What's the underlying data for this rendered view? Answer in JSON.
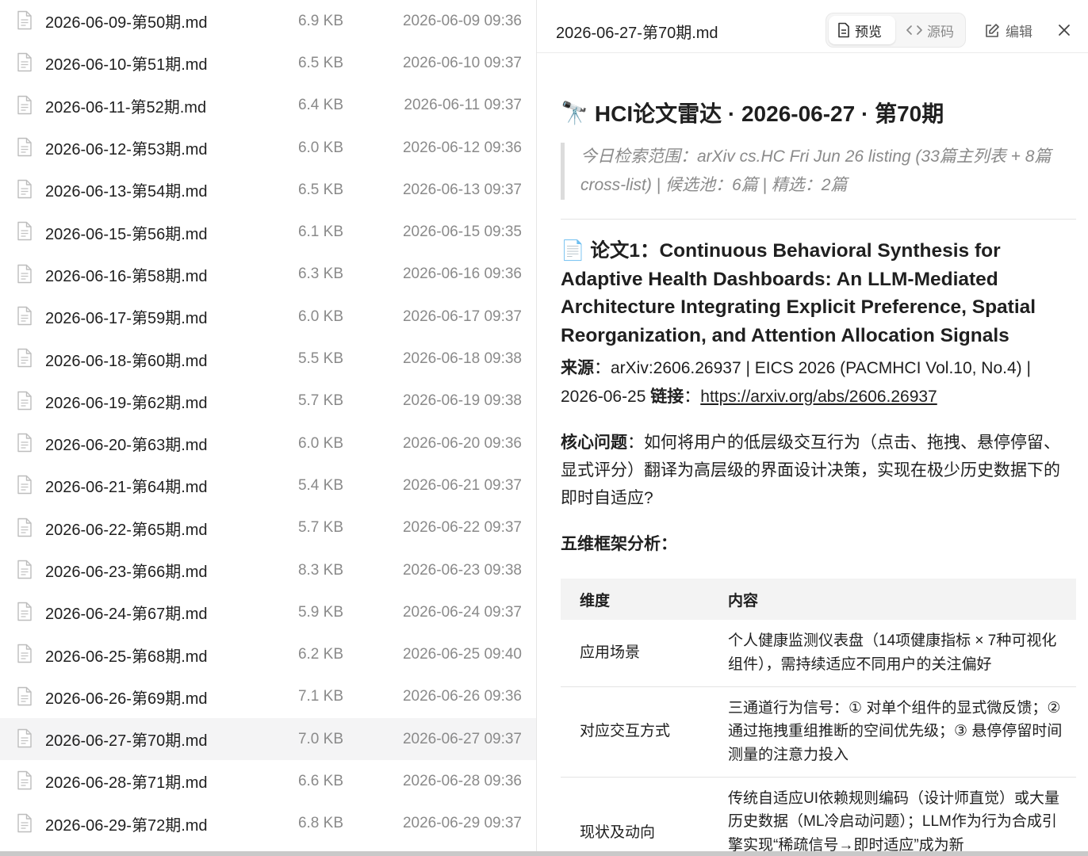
{
  "file_list": {
    "selected_index": 17,
    "files": [
      {
        "name": "2026-06-09-第50期.md",
        "size": "6.9 KB",
        "date": "2026-06-09 09:36"
      },
      {
        "name": "2026-06-10-第51期.md",
        "size": "6.5 KB",
        "date": "2026-06-10 09:37"
      },
      {
        "name": "2026-06-11-第52期.md",
        "size": "6.4 KB",
        "date": "2026-06-11 09:37"
      },
      {
        "name": "2026-06-12-第53期.md",
        "size": "6.0 KB",
        "date": "2026-06-12 09:36"
      },
      {
        "name": "2026-06-13-第54期.md",
        "size": "6.5 KB",
        "date": "2026-06-13 09:37"
      },
      {
        "name": "2026-06-15-第56期.md",
        "size": "6.1 KB",
        "date": "2026-06-15 09:35"
      },
      {
        "name": "2026-06-16-第58期.md",
        "size": "6.3 KB",
        "date": "2026-06-16 09:36"
      },
      {
        "name": "2026-06-17-第59期.md",
        "size": "6.0 KB",
        "date": "2026-06-17 09:37"
      },
      {
        "name": "2026-06-18-第60期.md",
        "size": "5.5 KB",
        "date": "2026-06-18 09:38"
      },
      {
        "name": "2026-06-19-第62期.md",
        "size": "5.7 KB",
        "date": "2026-06-19 09:38"
      },
      {
        "name": "2026-06-20-第63期.md",
        "size": "6.0 KB",
        "date": "2026-06-20 09:36"
      },
      {
        "name": "2026-06-21-第64期.md",
        "size": "5.4 KB",
        "date": "2026-06-21 09:37"
      },
      {
        "name": "2026-06-22-第65期.md",
        "size": "5.7 KB",
        "date": "2026-06-22 09:37"
      },
      {
        "name": "2026-06-23-第66期.md",
        "size": "8.3 KB",
        "date": "2026-06-23 09:38"
      },
      {
        "name": "2026-06-24-第67期.md",
        "size": "5.9 KB",
        "date": "2026-06-24 09:37"
      },
      {
        "name": "2026-06-25-第68期.md",
        "size": "6.2 KB",
        "date": "2026-06-25 09:40"
      },
      {
        "name": "2026-06-26-第69期.md",
        "size": "7.1 KB",
        "date": "2026-06-26 09:36"
      },
      {
        "name": "2026-06-27-第70期.md",
        "size": "7.0 KB",
        "date": "2026-06-27 09:37"
      },
      {
        "name": "2026-06-28-第71期.md",
        "size": "6.6 KB",
        "date": "2026-06-28 09:36"
      },
      {
        "name": "2026-06-29-第72期.md",
        "size": "6.8 KB",
        "date": "2026-06-29 09:37"
      }
    ]
  },
  "preview": {
    "filename": "2026-06-27-第70期.md",
    "tabs": {
      "preview": "预览",
      "source": "源码"
    },
    "edit_label": "编辑",
    "icons": {
      "file": "file-text-icon",
      "code": "code-icon",
      "edit": "edit-icon",
      "close": "close-icon"
    },
    "doc": {
      "title_emoji": "🔭",
      "title": "HCI论文雷达 · 2026-06-27 · 第70期",
      "quote": "今日检索范围：arXiv cs.HC Fri Jun 26 listing (33篇主列表 + 8篇cross-list) | 候选池：6篇 | 精选：2篇",
      "paper_emoji": "📄",
      "paper_title": "论文1：Continuous Behavioral Synthesis for Adaptive Health Dashboards: An LLM-Mediated Architecture Integrating Explicit Preference, Spatial Reorganization, and Attention Allocation Signals",
      "source_label": "来源",
      "source_text": "：arXiv:2606.26937 | EICS 2026 (PACMHCI Vol.10, No.4) | 2026-06-25 ",
      "link_label": "链接",
      "link_sep": "：",
      "link_url": "https://arxiv.org/abs/2606.26937",
      "core_label": "核心问题",
      "core_text": "：如何将用户的低层级交互行为（点击、拖拽、悬停停留、显式评分）翻译为高层级的界面设计决策，实现在极少历史数据下的即时自适应?",
      "five_dim_heading": "五维框架分析：",
      "table": {
        "headers": [
          "维度",
          "内容"
        ],
        "rows": [
          {
            "dim": "应用场景",
            "content": "个人健康监测仪表盘（14项健康指标 × 7种可视化组件），需持续适应不同用户的关注偏好"
          },
          {
            "dim": "对应交互方式",
            "content": "三通道行为信号：① 对单个组件的显式微反馈；② 通过拖拽重组推断的空间优先级；③ 悬停停留时间测量的注意力投入"
          },
          {
            "dim": "现状及动向",
            "content": "传统自适应UI依赖规则编码（设计师直觉）或大量历史数据（ML冷启动问题）；LLM作为行为合成引擎实现“稀疏信号→即时适应”成为新"
          }
        ]
      }
    }
  }
}
